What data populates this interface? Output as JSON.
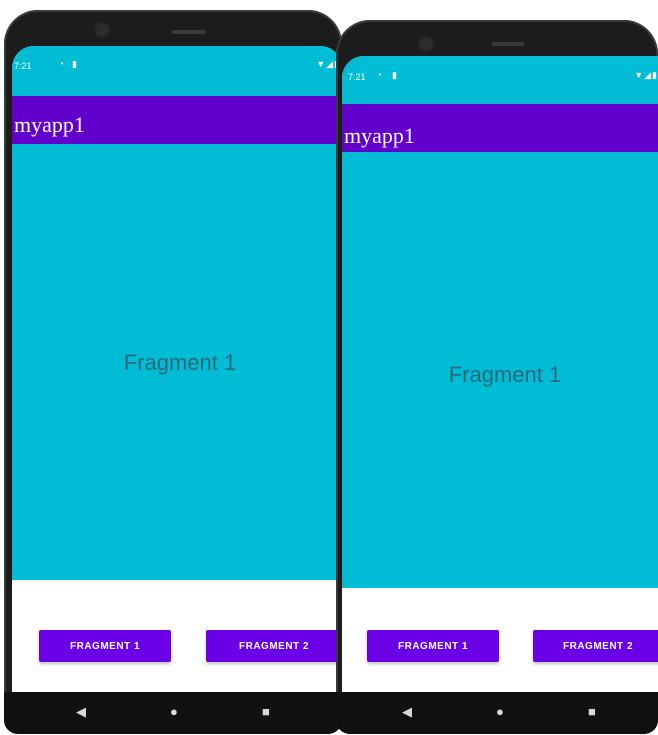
{
  "colors": {
    "status_bar": "#00bcd4",
    "app_bar": "#6200cc",
    "fragment_background": "#00bcd4",
    "button": "#6a00e6",
    "nav_bar": "#111111"
  },
  "phones": [
    {
      "status_bar": {
        "time": "7:21",
        "left_icons": [
          "sync-icon",
          "sd-card-icon"
        ],
        "right_icons": [
          "wifi-icon",
          "signal-icon",
          "battery-icon"
        ]
      },
      "app_bar": {
        "title": "myapp1"
      },
      "fragment": {
        "label": "Fragment 1"
      },
      "buttons": {
        "fragment1": "FRAGMENT 1",
        "fragment2": "FRAGMENT 2"
      },
      "nav_icons": [
        "back-icon",
        "home-icon",
        "recents-icon"
      ]
    },
    {
      "status_bar": {
        "time": "7:21",
        "left_icons": [
          "sync-icon",
          "sd-card-icon"
        ],
        "right_icons": [
          "wifi-icon",
          "signal-icon",
          "battery-icon"
        ]
      },
      "app_bar": {
        "title": "myapp1"
      },
      "fragment": {
        "label": "Fragment 1"
      },
      "buttons": {
        "fragment1": "FRAGMENT 1",
        "fragment2": "FRAGMENT 2"
      },
      "nav_icons": [
        "back-icon",
        "home-icon",
        "recents-icon"
      ]
    }
  ]
}
